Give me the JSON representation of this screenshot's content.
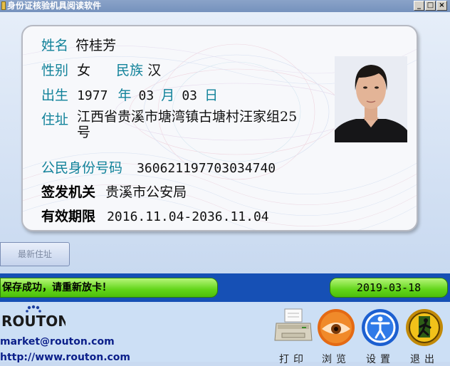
{
  "window": {
    "title": "身份证核验机具阅读软件",
    "controls": [
      "_",
      "□",
      "×"
    ]
  },
  "card": {
    "name_label": "姓名",
    "name": "符桂芳",
    "sex_label": "性别",
    "sex": "女",
    "ethnic_label": "民族",
    "ethnic": "汉",
    "birth_label": "出生",
    "birth_year": "1977",
    "year_label": "年",
    "birth_month": "03",
    "month_label": "月",
    "birth_day": "03",
    "day_label": "日",
    "address_label": "住址",
    "address_line1": "江西省贵溪市塘湾镇古塘村汪家组25",
    "address_line2": "号",
    "id_label": "公民身份号码",
    "id_number": "360621197703034740",
    "authority_label": "签发机关",
    "authority": "贵溪市公安局",
    "validity_label": "有效期限",
    "validity": "2016.11.04-2036.11.04"
  },
  "buttons": {
    "latest_address": "最新住址"
  },
  "status": {
    "message": "保存成功，请重新放卡！",
    "date": "2019-03-18"
  },
  "brand": {
    "logo": "ROUTON",
    "email": "market@routon.com",
    "website": "http://www.routon.com"
  },
  "toolbar": [
    {
      "label": "打印",
      "icon": "printer-icon"
    },
    {
      "label": "浏览",
      "icon": "eye-icon"
    },
    {
      "label": "设置",
      "icon": "accessibility-icon"
    },
    {
      "label": "退出",
      "icon": "exit-icon"
    }
  ]
}
